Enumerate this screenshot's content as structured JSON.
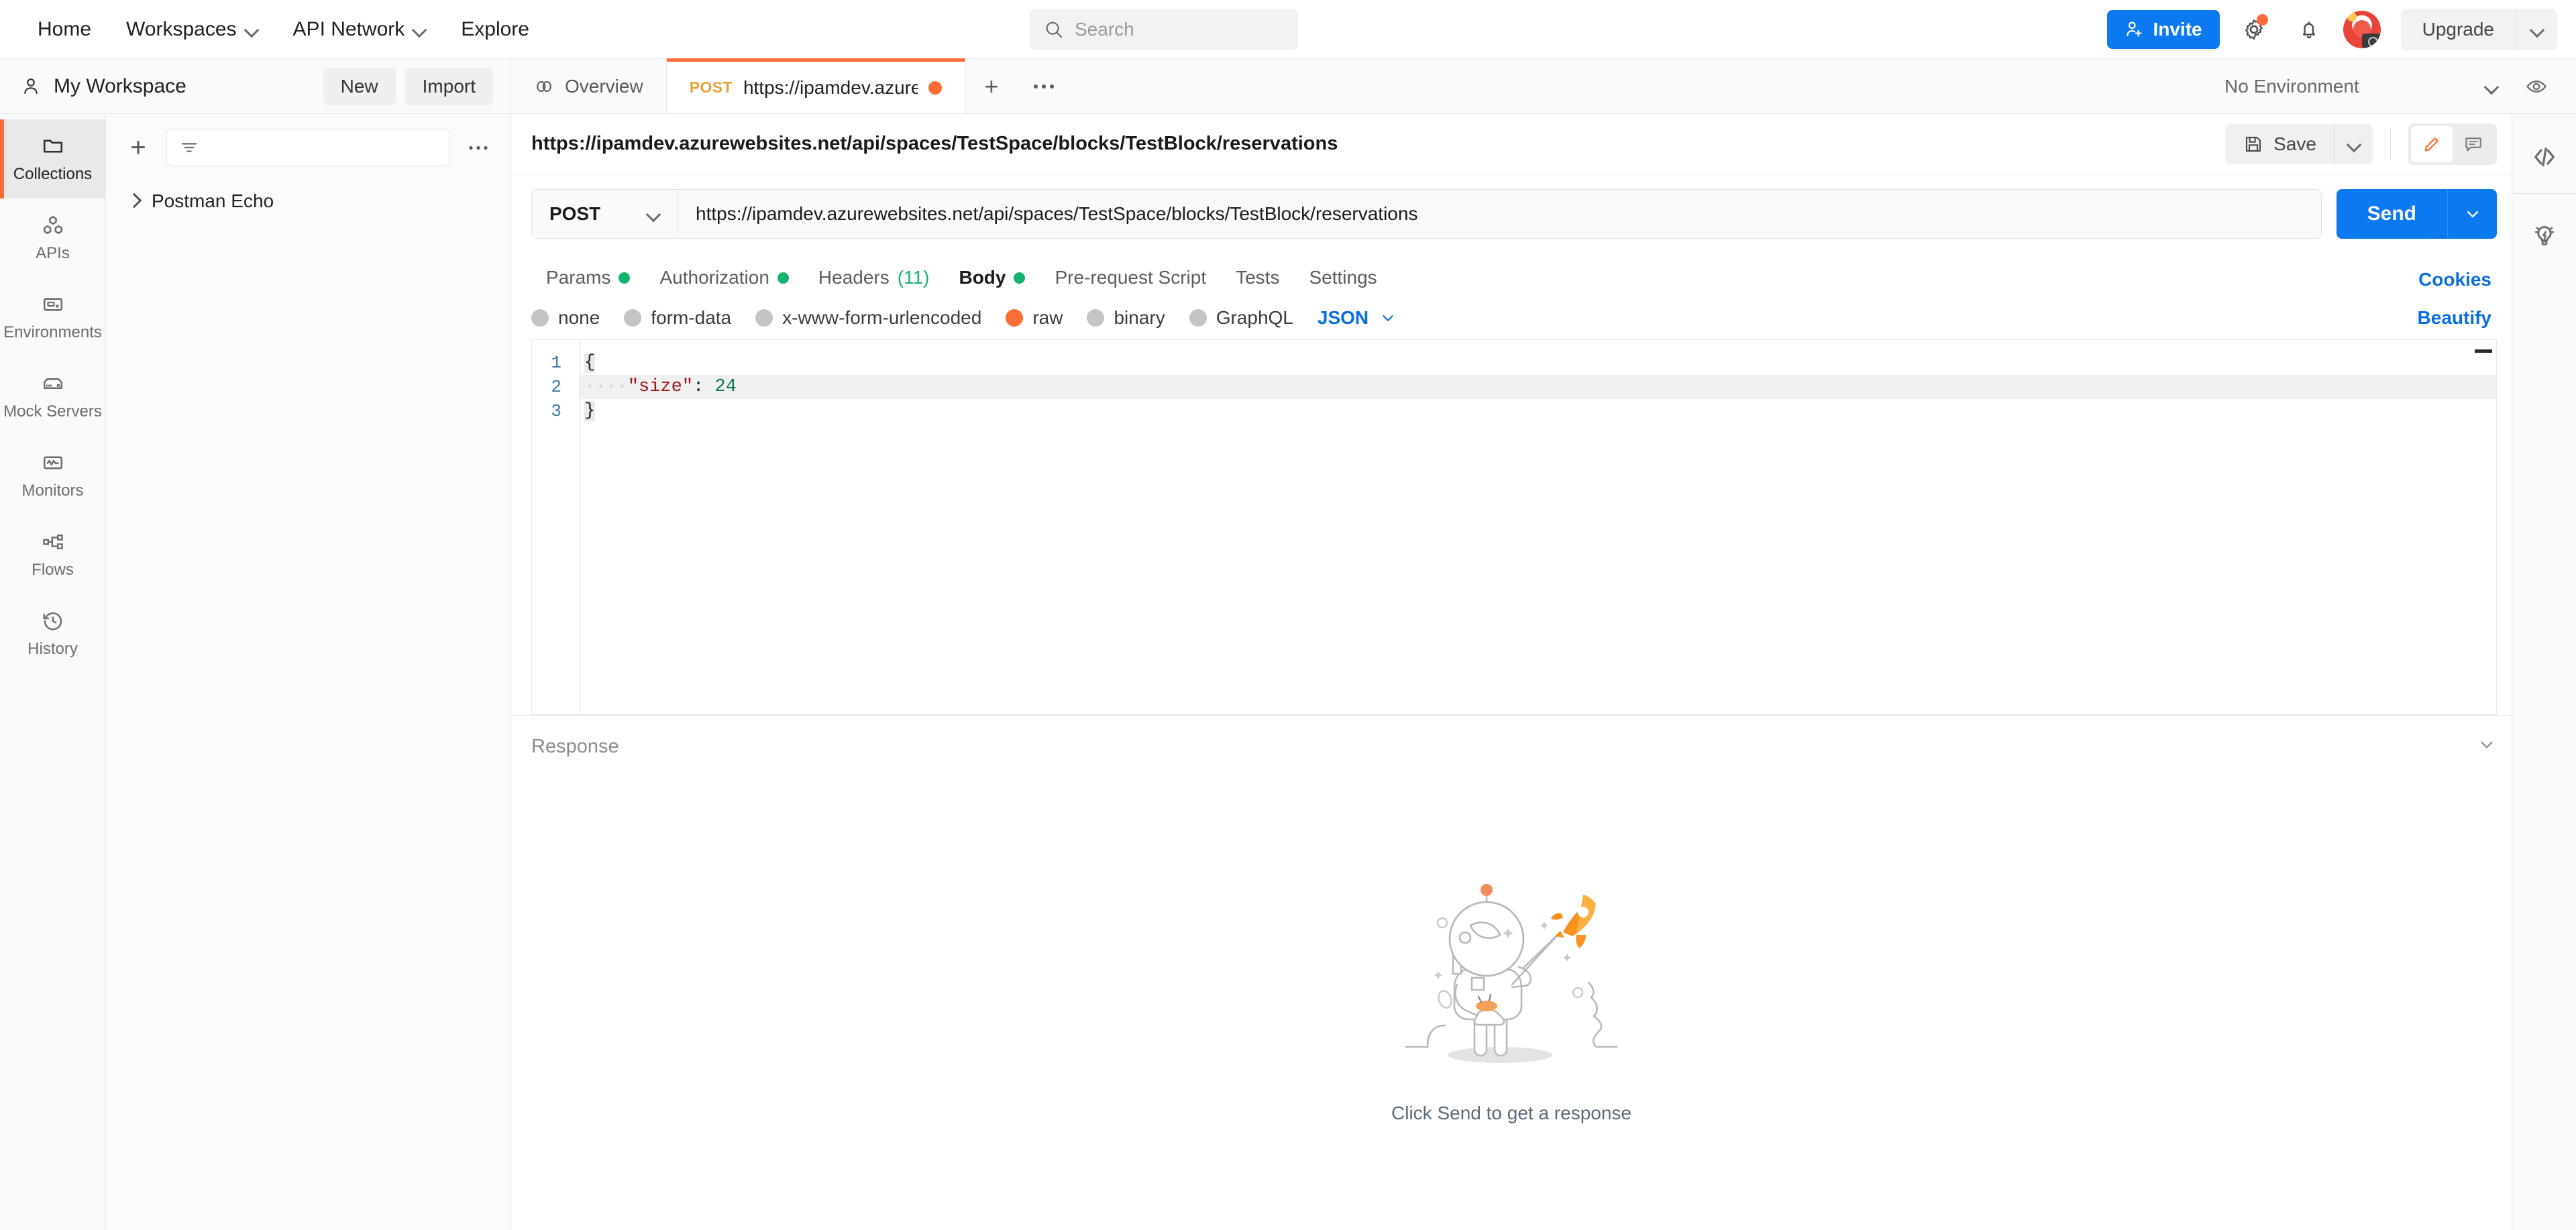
{
  "header": {
    "nav": [
      {
        "label": "Home",
        "has_caret": false
      },
      {
        "label": "Workspaces",
        "has_caret": true
      },
      {
        "label": "API Network",
        "has_caret": true
      },
      {
        "label": "Explore",
        "has_caret": false
      }
    ],
    "search": {
      "placeholder": "Search",
      "value": "",
      "icon": "search-icon"
    },
    "invite_label": "Invite",
    "settings_icon": "gear-icon",
    "notifications_icon": "bell-icon",
    "avatar_icon": "user-avatar",
    "upgrade_label": "Upgrade",
    "accent_blue": "#0b79f2",
    "accent_orange": "#ff6c37"
  },
  "workspace": {
    "icon": "person-icon",
    "name": "My Workspace",
    "new_label": "New",
    "import_label": "Import"
  },
  "tabs": [
    {
      "label": "Overview",
      "icon": "overview-icon",
      "method": "",
      "active": false,
      "unsaved": false
    },
    {
      "label": "https://ipamdev.azure",
      "icon": "",
      "method": "POST",
      "active": true,
      "unsaved": true
    }
  ],
  "tab_actions": {
    "new_tab": "+",
    "more": "•••"
  },
  "environment": {
    "selected": "No Environment",
    "eye_icon": "eye-icon"
  },
  "rail": [
    {
      "label": "Collections",
      "icon": "collections-icon",
      "active": true
    },
    {
      "label": "APIs",
      "icon": "apis-icon",
      "active": false
    },
    {
      "label": "Environments",
      "icon": "environments-icon",
      "active": false
    },
    {
      "label": "Mock Servers",
      "icon": "mock-servers-icon",
      "active": false
    },
    {
      "label": "Monitors",
      "icon": "monitors-icon",
      "active": false
    },
    {
      "label": "Flows",
      "icon": "flows-icon",
      "active": false
    },
    {
      "label": "History",
      "icon": "history-icon",
      "active": false
    }
  ],
  "sidebar": {
    "add_icon": "plus-icon",
    "filter_icon": "filter-icon",
    "filter_placeholder": "",
    "more_icon": "more-horizontal-icon",
    "items": [
      {
        "label": "Postman Echo",
        "icon": "chevron-right-icon"
      }
    ]
  },
  "request": {
    "title": "https://ipamdev.azurewebsites.net/api/spaces/TestSpace/blocks/TestBlock/reservations",
    "save_label": "Save",
    "save_icon": "floppy-disk-icon",
    "edit_icon": "pencil-icon",
    "comment_icon": "comment-icon",
    "method": "POST",
    "url": "https://ipamdev.azurewebsites.net/api/spaces/TestSpace/blocks/TestBlock/reservations",
    "send_label": "Send",
    "cookies_label": "Cookies",
    "beautify_label": "Beautify",
    "tabs": [
      {
        "label": "Params",
        "dot": true,
        "count": "",
        "active": false
      },
      {
        "label": "Authorization",
        "dot": true,
        "count": "",
        "active": false
      },
      {
        "label": "Headers",
        "dot": false,
        "count": "(11)",
        "active": false
      },
      {
        "label": "Body",
        "dot": true,
        "count": "",
        "active": true
      },
      {
        "label": "Pre-request Script",
        "dot": false,
        "count": "",
        "active": false
      },
      {
        "label": "Tests",
        "dot": false,
        "count": "",
        "active": false
      },
      {
        "label": "Settings",
        "dot": false,
        "count": "",
        "active": false
      }
    ],
    "body_types": [
      {
        "label": "none",
        "selected": false
      },
      {
        "label": "form-data",
        "selected": false
      },
      {
        "label": "x-www-form-urlencoded",
        "selected": false
      },
      {
        "label": "raw",
        "selected": true
      },
      {
        "label": "binary",
        "selected": false
      },
      {
        "label": "GraphQL",
        "selected": false
      }
    ],
    "raw_format": "JSON",
    "editor": {
      "lines": [
        "1",
        "2",
        "3"
      ],
      "line1": "{",
      "line2_indent": "····",
      "line2_key": "\"size\"",
      "line2_colon": ":",
      "line2_value": "24",
      "line3": "}"
    }
  },
  "response": {
    "title": "Response",
    "empty_message": "Click Send to get a response",
    "illustration": "astronaut-with-rocket"
  },
  "right_rail": [
    {
      "icon": "code-icon",
      "label": "code"
    },
    {
      "icon": "lightbulb-icon",
      "label": "tips"
    }
  ]
}
